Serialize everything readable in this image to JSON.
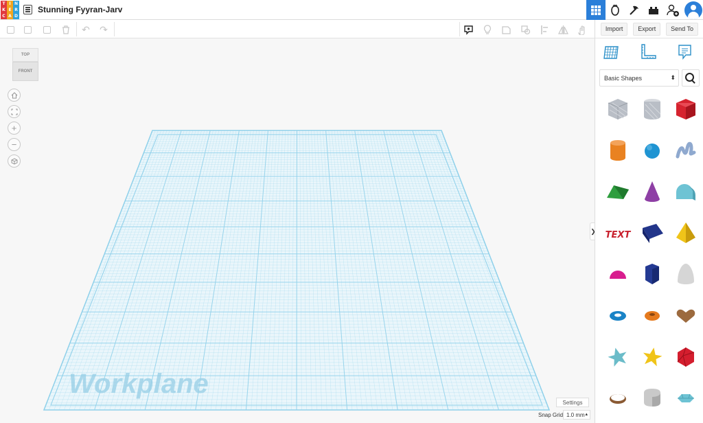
{
  "header": {
    "logo_letters": [
      "T",
      "I",
      "N",
      "K",
      "E",
      "R",
      "C",
      "A",
      "D"
    ],
    "logo_colors": [
      "#e1393d",
      "#f2a51f",
      "#2fa2db",
      "#e1393d",
      "#f2a51f",
      "#2fa2db",
      "#e1393d",
      "#f2a51f",
      "#2fa2db"
    ],
    "design_title": "Stunning Fyyran-Jarv",
    "icons": [
      "3d-design-view-icon",
      "circuits-icon",
      "codeblocks-icon",
      "lego-bricks-icon",
      "invite-user-icon",
      "user-avatar-icon"
    ]
  },
  "toolbar": {
    "buttons": [
      "copy-icon",
      "paste-icon",
      "duplicate-icon",
      "delete-icon",
      "undo-icon",
      "redo-icon"
    ],
    "view_buttons": [
      "notes-icon",
      "light-icon",
      "shape-hole-icon",
      "group-icon",
      "align-icon",
      "mirror-icon",
      "hand-icon"
    ]
  },
  "panel": {
    "import_label": "Import",
    "export_label": "Export",
    "sendto_label": "Send To",
    "category": "Basic Shapes",
    "tool_icons": [
      "workplane-icon",
      "ruler-icon",
      "notes-panel-icon"
    ],
    "shapes": [
      {
        "name": "box-hole",
        "color": "#b9bec6"
      },
      {
        "name": "cylinder-hole",
        "color": "#b9bec6"
      },
      {
        "name": "box",
        "color": "#d6232f"
      },
      {
        "name": "cylinder",
        "color": "#e98221"
      },
      {
        "name": "sphere",
        "color": "#1f94d2"
      },
      {
        "name": "scribble",
        "color": "#8fa9cf"
      },
      {
        "name": "roof",
        "color": "#2e9e3e"
      },
      {
        "name": "cone",
        "color": "#8e3fa5"
      },
      {
        "name": "round-roof",
        "color": "#6ec3d4"
      },
      {
        "name": "text",
        "color": "#c8202d"
      },
      {
        "name": "wedge",
        "color": "#22358a"
      },
      {
        "name": "pyramid",
        "color": "#f0c419"
      },
      {
        "name": "half-sphere",
        "color": "#d81d8e"
      },
      {
        "name": "polygon",
        "color": "#243a93"
      },
      {
        "name": "paraboloid",
        "color": "#d6d6d6"
      },
      {
        "name": "torus",
        "color": "#1a83c6"
      },
      {
        "name": "tube",
        "color": "#e57a1e"
      },
      {
        "name": "heart",
        "color": "#9c6a3e"
      },
      {
        "name": "star",
        "color": "#6bbcc9"
      },
      {
        "name": "star-yellow",
        "color": "#f0c419"
      },
      {
        "name": "icosahedron",
        "color": "#d41e2e"
      },
      {
        "name": "ring",
        "color": "#8a5a33"
      },
      {
        "name": "rounded-box",
        "color": "#c9c9c9"
      },
      {
        "name": "gem",
        "color": "#6ec3d4"
      }
    ]
  },
  "viewcube": {
    "top_label": "TOP",
    "front_label": "FRONT"
  },
  "view_controls": [
    "home-view-icon",
    "fit-view-icon",
    "zoom-in-icon",
    "zoom-out-icon",
    "perspective-icon"
  ],
  "workplane": {
    "label": "Workplane",
    "settings_label": "Settings",
    "snap_label": "Snap Grid",
    "snap_value": "1.0 mm",
    "grid_color": "#8fd0ea"
  }
}
